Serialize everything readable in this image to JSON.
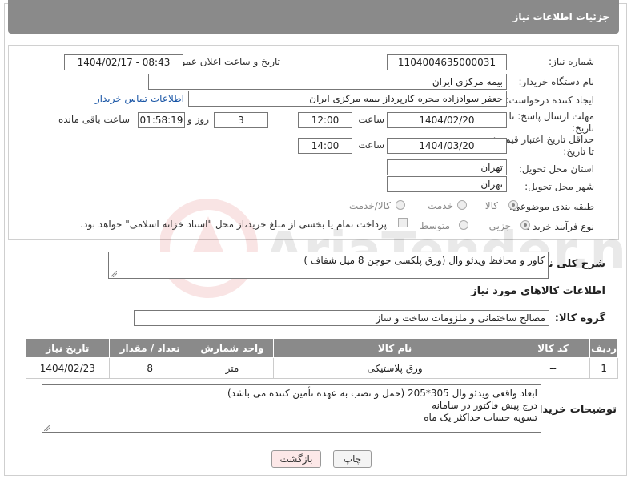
{
  "header": {
    "title": "جزئیات اطلاعات نیاز"
  },
  "form": {
    "need_number_label": "شماره نیاز:",
    "need_number": "1104004635000031",
    "announce_label": "تاریخ و ساعت اعلان عمومی:",
    "announce_value": "1404/02/17 - 08:43",
    "buyer_org_label": "نام دستگاه خریدار:",
    "buyer_org": "بیمه مرکزی ایران",
    "creator_label": "ایجاد کننده درخواست:",
    "creator": "جعفر سوادزاده مجره کارپرداز بیمه مرکزی ایران",
    "contact_link": "اطلاعات تماس خریدار",
    "reply_deadline_label": "مهلت ارسال پاسخ: تا تاریخ:",
    "reply_date": "1404/02/20",
    "time_label": "ساعت",
    "reply_time": "12:00",
    "days_count": "3",
    "days_label": "روز و",
    "remaining_time": "01:58:19",
    "remaining_label": "ساعت باقی مانده",
    "price_deadline_label": "حداقل تاریخ اعتبار قیمت: تا تاریخ:",
    "price_date": "1404/03/20",
    "price_time": "14:00",
    "province_label": "استان محل تحویل:",
    "province": "تهران",
    "city_label": "شهر محل تحویل:",
    "city": "تهران",
    "category_label": "طبقه بندی موضوعی:",
    "category_options": [
      "کالا",
      "خدمت",
      "کالا/خدمت"
    ],
    "process_label": "نوع فرآیند خرید :",
    "process_options": [
      "جزیی",
      "متوسط"
    ],
    "payment_note": "پرداخت تمام یا بخشی از مبلغ خرید،از محل \"اسناد خزانه اسلامی\" خواهد بود."
  },
  "description": {
    "label": "شرح کلی نیاز:",
    "value": "کاور و محافظ ویدئو وال (ورق پلکسی چوچن 8 میل شفاف )"
  },
  "goods_section": {
    "title": "اطلاعات کالاهای مورد نیاز",
    "group_label": "گروه کالا:",
    "group_value": "مصالح ساختمانی و ملزومات ساخت و ساز"
  },
  "table": {
    "headers": [
      "ردیف",
      "کد کالا",
      "نام کالا",
      "واحد شمارش",
      "تعداد / مقدار",
      "تاریخ نیاز"
    ],
    "rows": [
      [
        "1",
        "--",
        "ورق پلاستیکی",
        "متر",
        "8",
        "1404/02/23"
      ]
    ]
  },
  "buyer_notes": {
    "label": "توضیحات خریدار:",
    "lines": [
      "ابعاد واقعی ویدئو وال 305*205 (حمل و نصب به عهده تأمین کننده می باشد)",
      "درج پیش فاکتور در سامانه",
      "تسویه حساب حداکثر یک ماه"
    ]
  },
  "buttons": {
    "print": "چاپ",
    "back": "بازگشت"
  },
  "watermark": {
    "text": "AriaTender.neT"
  },
  "colors": {
    "header_bg": "#8a8a8a",
    "link": "#1a56a6",
    "back_button_bg": "#fde8e8"
  }
}
